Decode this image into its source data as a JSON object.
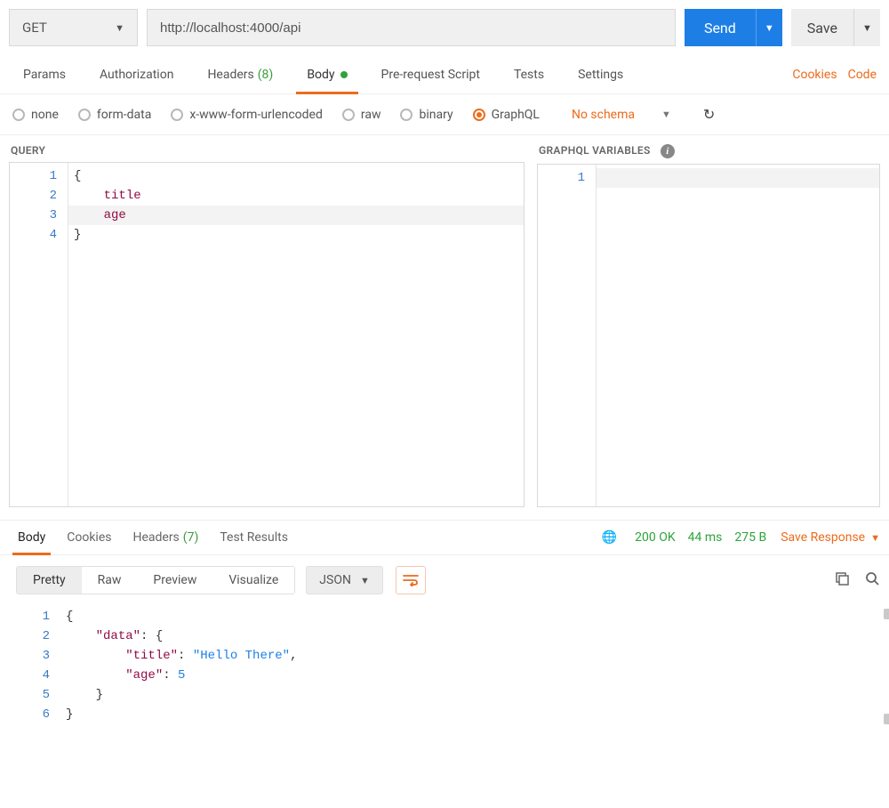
{
  "request": {
    "method": "GET",
    "url": "http://localhost:4000/api",
    "send_label": "Send",
    "save_label": "Save"
  },
  "tabs": {
    "items": [
      {
        "id": "params",
        "label": "Params"
      },
      {
        "id": "auth",
        "label": "Authorization"
      },
      {
        "id": "headers",
        "label": "Headers",
        "count": "(8)"
      },
      {
        "id": "body",
        "label": "Body",
        "active": true,
        "dot": true
      },
      {
        "id": "prerequest",
        "label": "Pre-request Script"
      },
      {
        "id": "tests",
        "label": "Tests"
      },
      {
        "id": "settings",
        "label": "Settings"
      }
    ],
    "cookies_label": "Cookies",
    "code_label": "Code"
  },
  "body_types": {
    "options": [
      {
        "id": "none",
        "label": "none"
      },
      {
        "id": "form-data",
        "label": "form-data"
      },
      {
        "id": "urlencoded",
        "label": "x-www-form-urlencoded"
      },
      {
        "id": "raw",
        "label": "raw"
      },
      {
        "id": "binary",
        "label": "binary"
      },
      {
        "id": "graphql",
        "label": "GraphQL",
        "selected": true
      }
    ],
    "schema_label": "No schema"
  },
  "query": {
    "label": "QUERY",
    "lines": [
      {
        "n": 1,
        "text": "{"
      },
      {
        "n": 2,
        "indent": "    ",
        "prop": "title"
      },
      {
        "n": 3,
        "indent": "    ",
        "prop": "age",
        "hl": true
      },
      {
        "n": 4,
        "text": "}"
      }
    ]
  },
  "variables": {
    "label": "GRAPHQL VARIABLES",
    "lines": [
      {
        "n": 1
      }
    ]
  },
  "response_tabs": {
    "items": [
      {
        "id": "body",
        "label": "Body",
        "active": true
      },
      {
        "id": "cookies",
        "label": "Cookies"
      },
      {
        "id": "headers",
        "label": "Headers",
        "count": "(7)"
      },
      {
        "id": "tests",
        "label": "Test Results"
      }
    ],
    "status": "200 OK",
    "time": "44 ms",
    "size": "275 B",
    "save_label": "Save Response"
  },
  "resp_toolbar": {
    "prettify": "Pretty",
    "raw": "Raw",
    "preview": "Preview",
    "visualize": "Visualize",
    "format": "JSON"
  },
  "response_body": {
    "lines": [
      {
        "n": 1,
        "type": "punct",
        "text": "{"
      },
      {
        "n": 2,
        "indent": "    ",
        "key": "\"data\"",
        "sep": ": ",
        "after": "{"
      },
      {
        "n": 3,
        "indent": "        ",
        "key": "\"title\"",
        "sep": ": ",
        "str": "\"Hello There\"",
        "trail": ","
      },
      {
        "n": 4,
        "indent": "        ",
        "key": "\"age\"",
        "sep": ": ",
        "num": "5"
      },
      {
        "n": 5,
        "indent": "    ",
        "type": "punct",
        "text": "}"
      },
      {
        "n": 6,
        "type": "punct",
        "text": "}"
      }
    ]
  }
}
